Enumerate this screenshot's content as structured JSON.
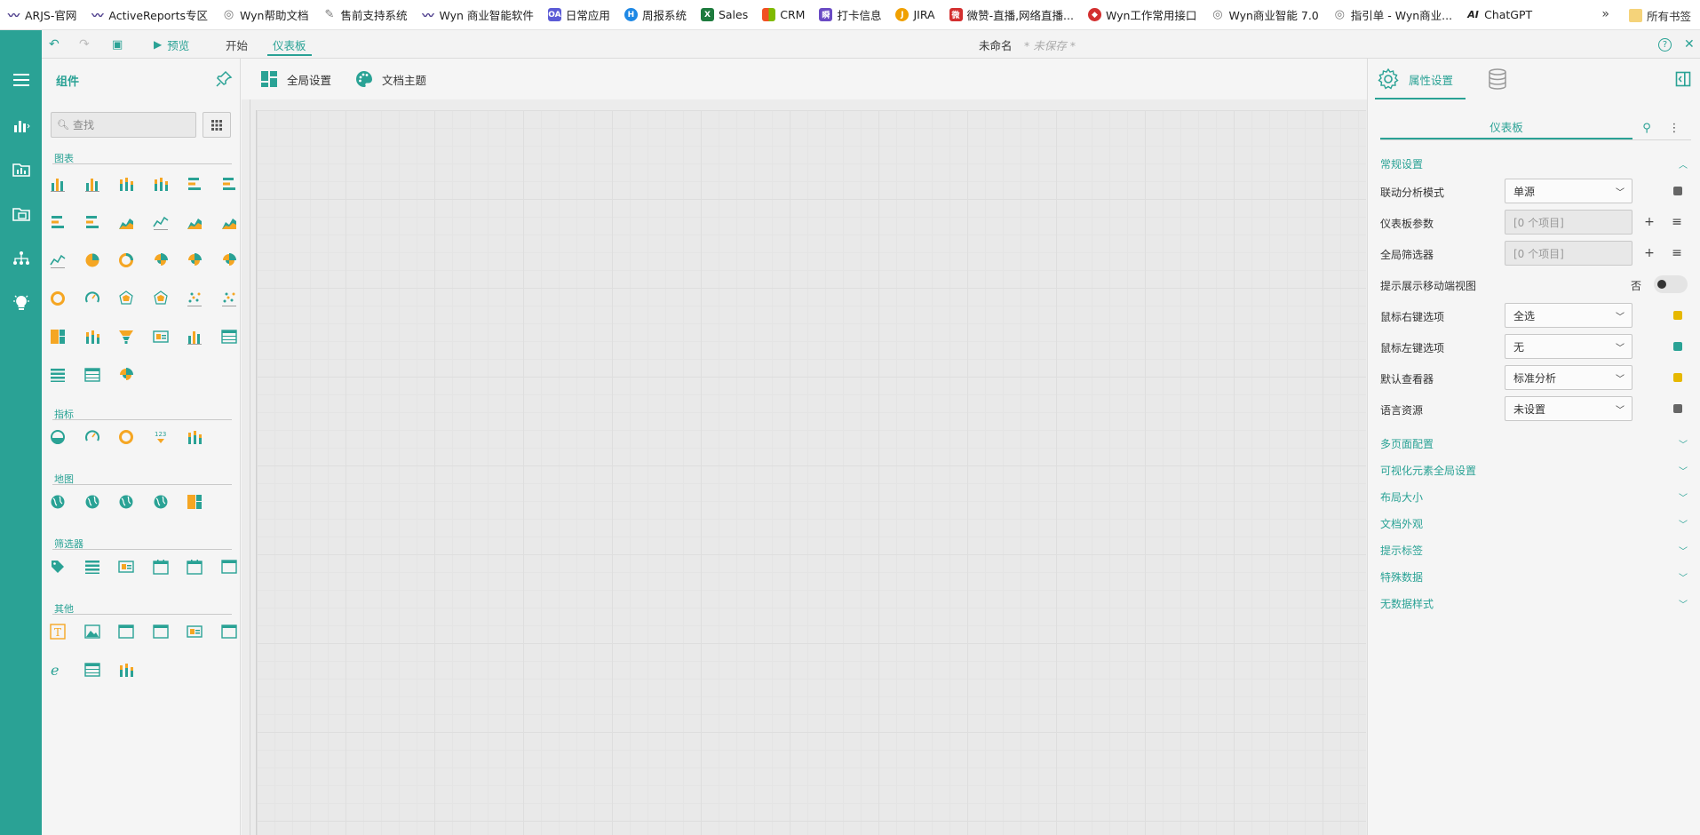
{
  "bookmarks": [
    {
      "label": "ARJS-官网",
      "color": "#4a3a8a",
      "icon": "logo-icon"
    },
    {
      "label": "ActiveReports专区",
      "color": "#4a3a8a",
      "icon": "logo-icon"
    },
    {
      "label": "Wyn帮助文档",
      "color": "#777777",
      "icon": "globe-icon"
    },
    {
      "label": "售前支持系统",
      "color": "#777777",
      "icon": "pen-icon"
    },
    {
      "label": "Wyn 商业智能软件",
      "color": "#4a3a8a",
      "icon": "logo-icon"
    },
    {
      "label": "日常应用",
      "color": "#5b5bd6",
      "icon": "oa-icon",
      "glyph": "OA"
    },
    {
      "label": "周报系统",
      "color": "#1e88e5",
      "icon": "h-icon",
      "glyph": "H"
    },
    {
      "label": "Sales",
      "color": "#1e7b3e",
      "icon": "excel-icon",
      "glyph": "X"
    },
    {
      "label": "CRM",
      "color": "#e53935",
      "icon": "windows-icon",
      "glyph": "■"
    },
    {
      "label": "打卡信息",
      "color": "#6a4bc4",
      "icon": "calendar-icon",
      "glyph": "瞬"
    },
    {
      "label": "JIRA",
      "color": "#f0a000",
      "icon": "jira-icon",
      "glyph": "J"
    },
    {
      "label": "微赞-直播,网络直播...",
      "color": "#d32f2f",
      "icon": "weizan-icon",
      "glyph": "微"
    },
    {
      "label": "Wyn工作常用接口",
      "color": "#d32f2f",
      "icon": "shield-icon",
      "glyph": "◆"
    },
    {
      "label": "Wyn商业智能 7.0",
      "color": "#777777",
      "icon": "globe-icon"
    },
    {
      "label": "指引单 - Wyn商业...",
      "color": "#777777",
      "icon": "globe-icon"
    },
    {
      "label": "ChatGPT",
      "color": "#222222",
      "icon": "ai-icon",
      "glyph": "AI"
    }
  ],
  "bookmarks_more": "»",
  "bookmarks_all": "所有书签",
  "toolbar": {
    "undo": "↶",
    "redo": "↷",
    "save": "▣",
    "preview_icon": "▶",
    "preview_label": "预览",
    "start_label": "开始",
    "dashboard_label": "仪表板",
    "doc_title": "未命名",
    "doc_status": "* 未保存 *",
    "help": "?",
    "close": "✕"
  },
  "components": {
    "title": "组件",
    "search_placeholder": "查找",
    "sections": {
      "charts": "图表",
      "indicators": "指标",
      "maps": "地图",
      "filters": "筛选器",
      "others": "其他"
    }
  },
  "canvas_tabs": {
    "global_settings": "全局设置",
    "doc_theme": "文档主题"
  },
  "right_panel": {
    "tab_properties": "属性设置",
    "sub_title": "仪表板",
    "section_general": "常规设置",
    "props": [
      {
        "label": "联动分析模式",
        "value": "单源",
        "type": "select",
        "marker": "#666666"
      },
      {
        "label": "仪表板参数",
        "value": "[0 个项目]",
        "type": "list"
      },
      {
        "label": "全局筛选器",
        "value": "[0 个项目]",
        "type": "list"
      },
      {
        "label": "提示展示移动端视图",
        "value": "否",
        "type": "toggle"
      },
      {
        "label": "鼠标右键选项",
        "value": "全选",
        "type": "select",
        "marker": "#e6b800"
      },
      {
        "label": "鼠标左键选项",
        "value": "无",
        "type": "select",
        "marker": "#2aa295"
      },
      {
        "label": "默认查看器",
        "value": "标准分析",
        "type": "select",
        "marker": "#e6b800"
      },
      {
        "label": "语言资源",
        "value": "未设置",
        "type": "select",
        "marker": "#666666"
      }
    ],
    "collapsed_sections": [
      "多页面配置",
      "可视化元素全局设置",
      "布局大小",
      "文档外观",
      "提示标签",
      "特殊数据",
      "无数据样式"
    ]
  },
  "colors": {
    "accent": "#2aa295",
    "accent_orange": "#f5a623",
    "canvas": "#e9e9e9"
  }
}
